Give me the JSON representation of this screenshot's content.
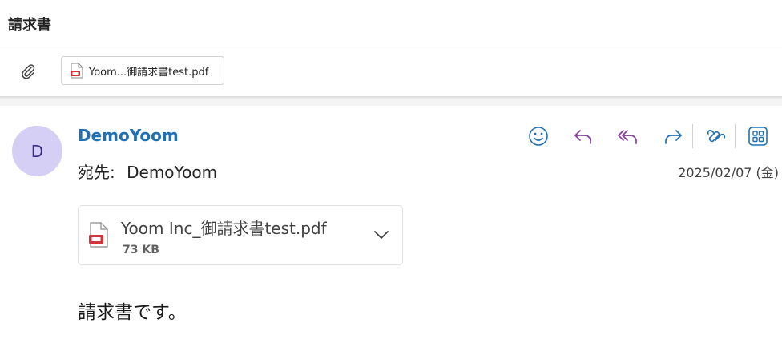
{
  "subject": "請求書",
  "attachment_strip": {
    "chip_label": "Yoom...御請求書test.pdf"
  },
  "message": {
    "avatar_initial": "D",
    "sender": "DemoYoom",
    "to_label": "宛先:",
    "to_value": "DemoYoom",
    "date": "2025/02/07 (金)",
    "actions": [
      "emoji-icon",
      "reply-icon",
      "reply-all-icon",
      "forward-icon",
      "copilot-icon",
      "apps-icon"
    ],
    "attachment": {
      "name": "Yoom Inc_御請求書test.pdf",
      "size": "73 KB"
    },
    "body": "請求書です。"
  },
  "colors": {
    "sender": "#1f6fb5",
    "avatar_bg": "#d5cff5",
    "reply_purple": "#8a3aa0",
    "forward_blue": "#1f6fb5",
    "pdf_red": "#d13438"
  }
}
